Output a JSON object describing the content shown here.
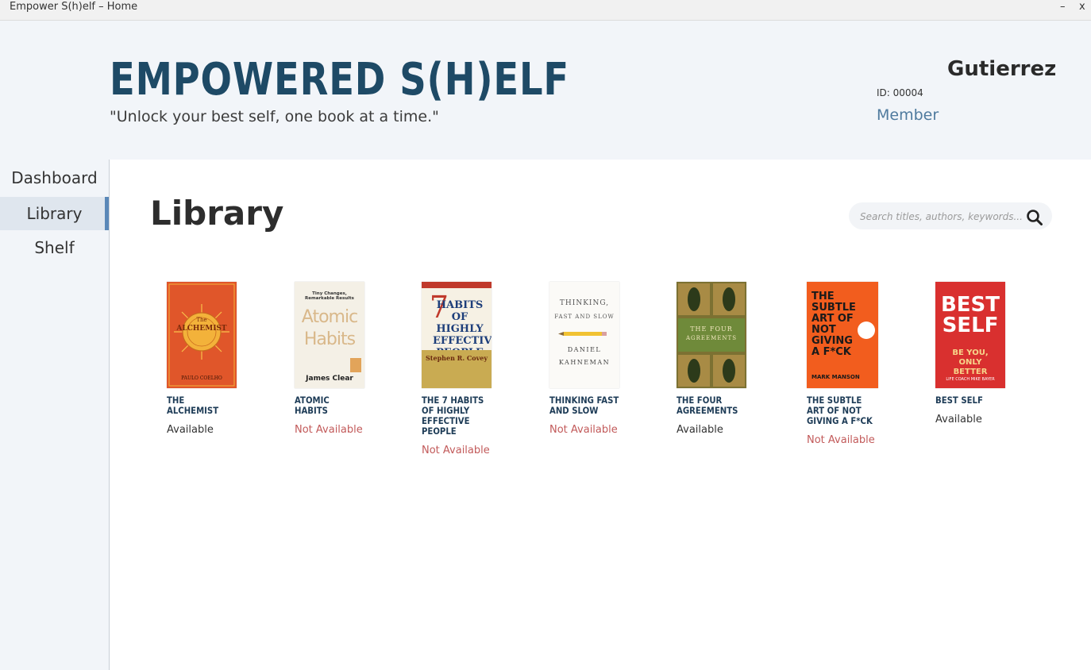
{
  "window": {
    "title": "Empower S(h)elf – Home",
    "minimize_label": "–",
    "close_label": "x"
  },
  "header": {
    "brand": "EMPOWERED S(H)ELF",
    "tagline": "\"Unlock your best self, one book at a time.\"",
    "user": {
      "name": "Gutierrez",
      "id": "ID: 00004",
      "role": "Member"
    }
  },
  "sidebar": {
    "items": [
      {
        "label": "Dashboard",
        "active": false
      },
      {
        "label": "Library",
        "active": true
      },
      {
        "label": "Shelf",
        "active": false
      }
    ]
  },
  "main": {
    "title": "Library",
    "search": {
      "placeholder": "Search titles, authors, keywords..."
    },
    "books": [
      {
        "title": "THE ALCHEMIST",
        "status": "Available",
        "available": true,
        "cover": {
          "bg": "#e0562a",
          "line1": "The",
          "line2": "ALCHEMIST",
          "author": "PAULO COELHO"
        }
      },
      {
        "title": "ATOMIC HABITS",
        "status": "Not Available",
        "available": false,
        "cover": {
          "bg": "#f4f0e6",
          "line1": "Tiny Changes, Remarkable Results",
          "line2": "Atomic",
          "line3": "Habits",
          "author": "James Clear"
        }
      },
      {
        "title": "THE 7 HABITS OF HIGHLY EFFECTIVE PEOPLE",
        "status": "Not Available",
        "available": false,
        "cover": {
          "bg": "#f6f1e4",
          "line1": "7",
          "line2": "HABITS OF HIGHLY EFFECTIVE PEOPLE",
          "author": "Stephen R. Covey"
        }
      },
      {
        "title": "THINKING FAST AND SLOW",
        "status": "Not Available",
        "available": false,
        "cover": {
          "bg": "#fbfaf7",
          "line1": "THINKING,",
          "line2": "FAST AND SLOW",
          "author": "DANIEL KAHNEMAN"
        }
      },
      {
        "title": "THE FOUR AGREEMENTS",
        "status": "Available",
        "available": true,
        "cover": {
          "bg": "#8a7a3a",
          "line1": "THE FOUR",
          "line2": "AGREEMENTS"
        }
      },
      {
        "title": "THE SUBTLE ART OF NOT GIVING A F*CK",
        "status": "Not Available",
        "available": false,
        "cover": {
          "bg": "#f25d1e",
          "line1": "THE SUBTLE ART OF NOT GIVING A F*CK",
          "author": "MARK MANSON"
        }
      },
      {
        "title": "BEST SELF",
        "status": "Available",
        "available": true,
        "cover": {
          "bg": "#d9302f",
          "line1": "BEST",
          "line2": "SELF",
          "line3": "BE YOU, ONLY BETTER",
          "author": "LIFE COACH MIKE BAYER"
        }
      }
    ]
  },
  "colors": {
    "brand": "#1e4a66",
    "accent": "#5a88b8",
    "available": "#333333",
    "unavailable": "#c25a5a"
  }
}
